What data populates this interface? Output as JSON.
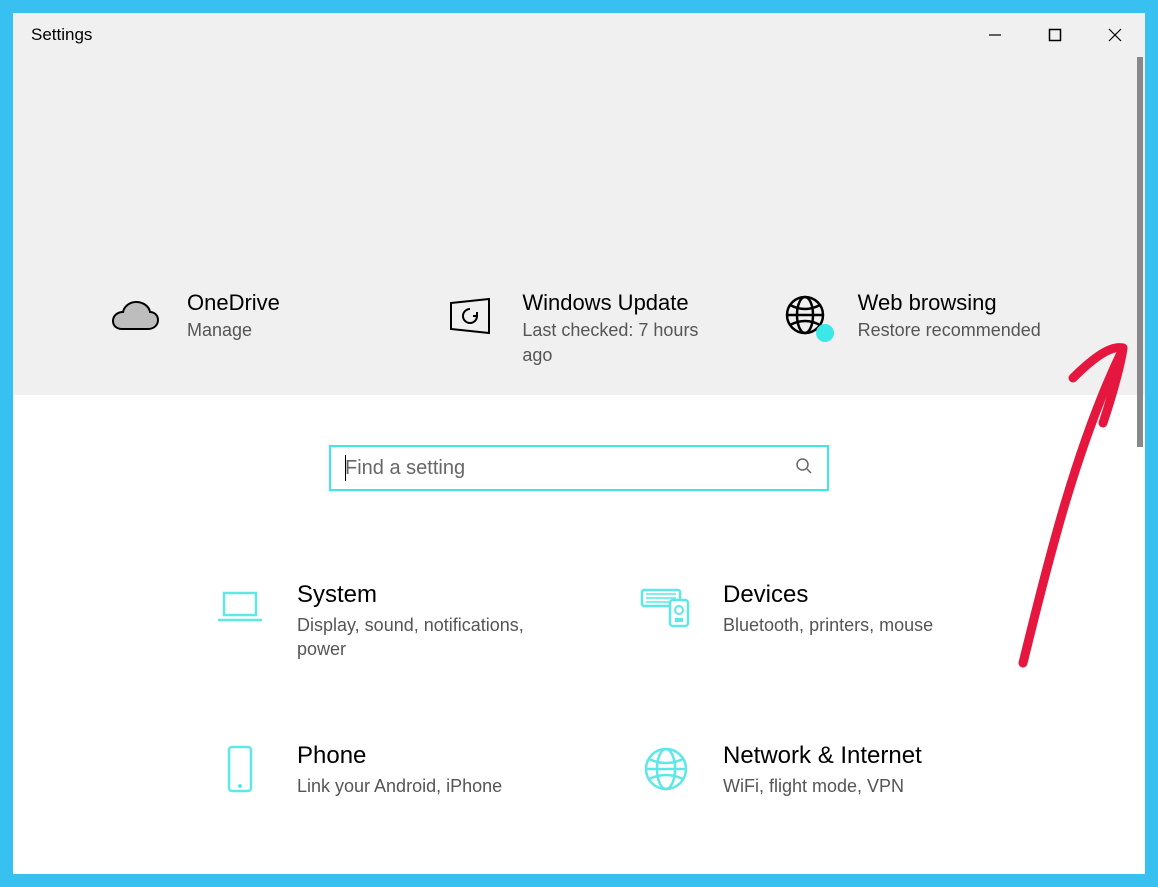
{
  "window": {
    "title": "Settings"
  },
  "status": {
    "onedrive": {
      "title": "OneDrive",
      "sub": "Manage"
    },
    "update": {
      "title": "Windows Update",
      "sub": "Last checked: 7 hours ago"
    },
    "browsing": {
      "title": "Web browsing",
      "sub": "Restore recommended"
    }
  },
  "search": {
    "placeholder": "Find a setting"
  },
  "categories": {
    "system": {
      "title": "System",
      "sub": "Display, sound, notifications, power"
    },
    "devices": {
      "title": "Devices",
      "sub": "Bluetooth, printers, mouse"
    },
    "phone": {
      "title": "Phone",
      "sub": "Link your Android, iPhone"
    },
    "network": {
      "title": "Network & Internet",
      "sub": "WiFi, flight mode, VPN"
    }
  },
  "colors": {
    "accent": "#3ce7e7",
    "annotation": "#e6173e"
  }
}
